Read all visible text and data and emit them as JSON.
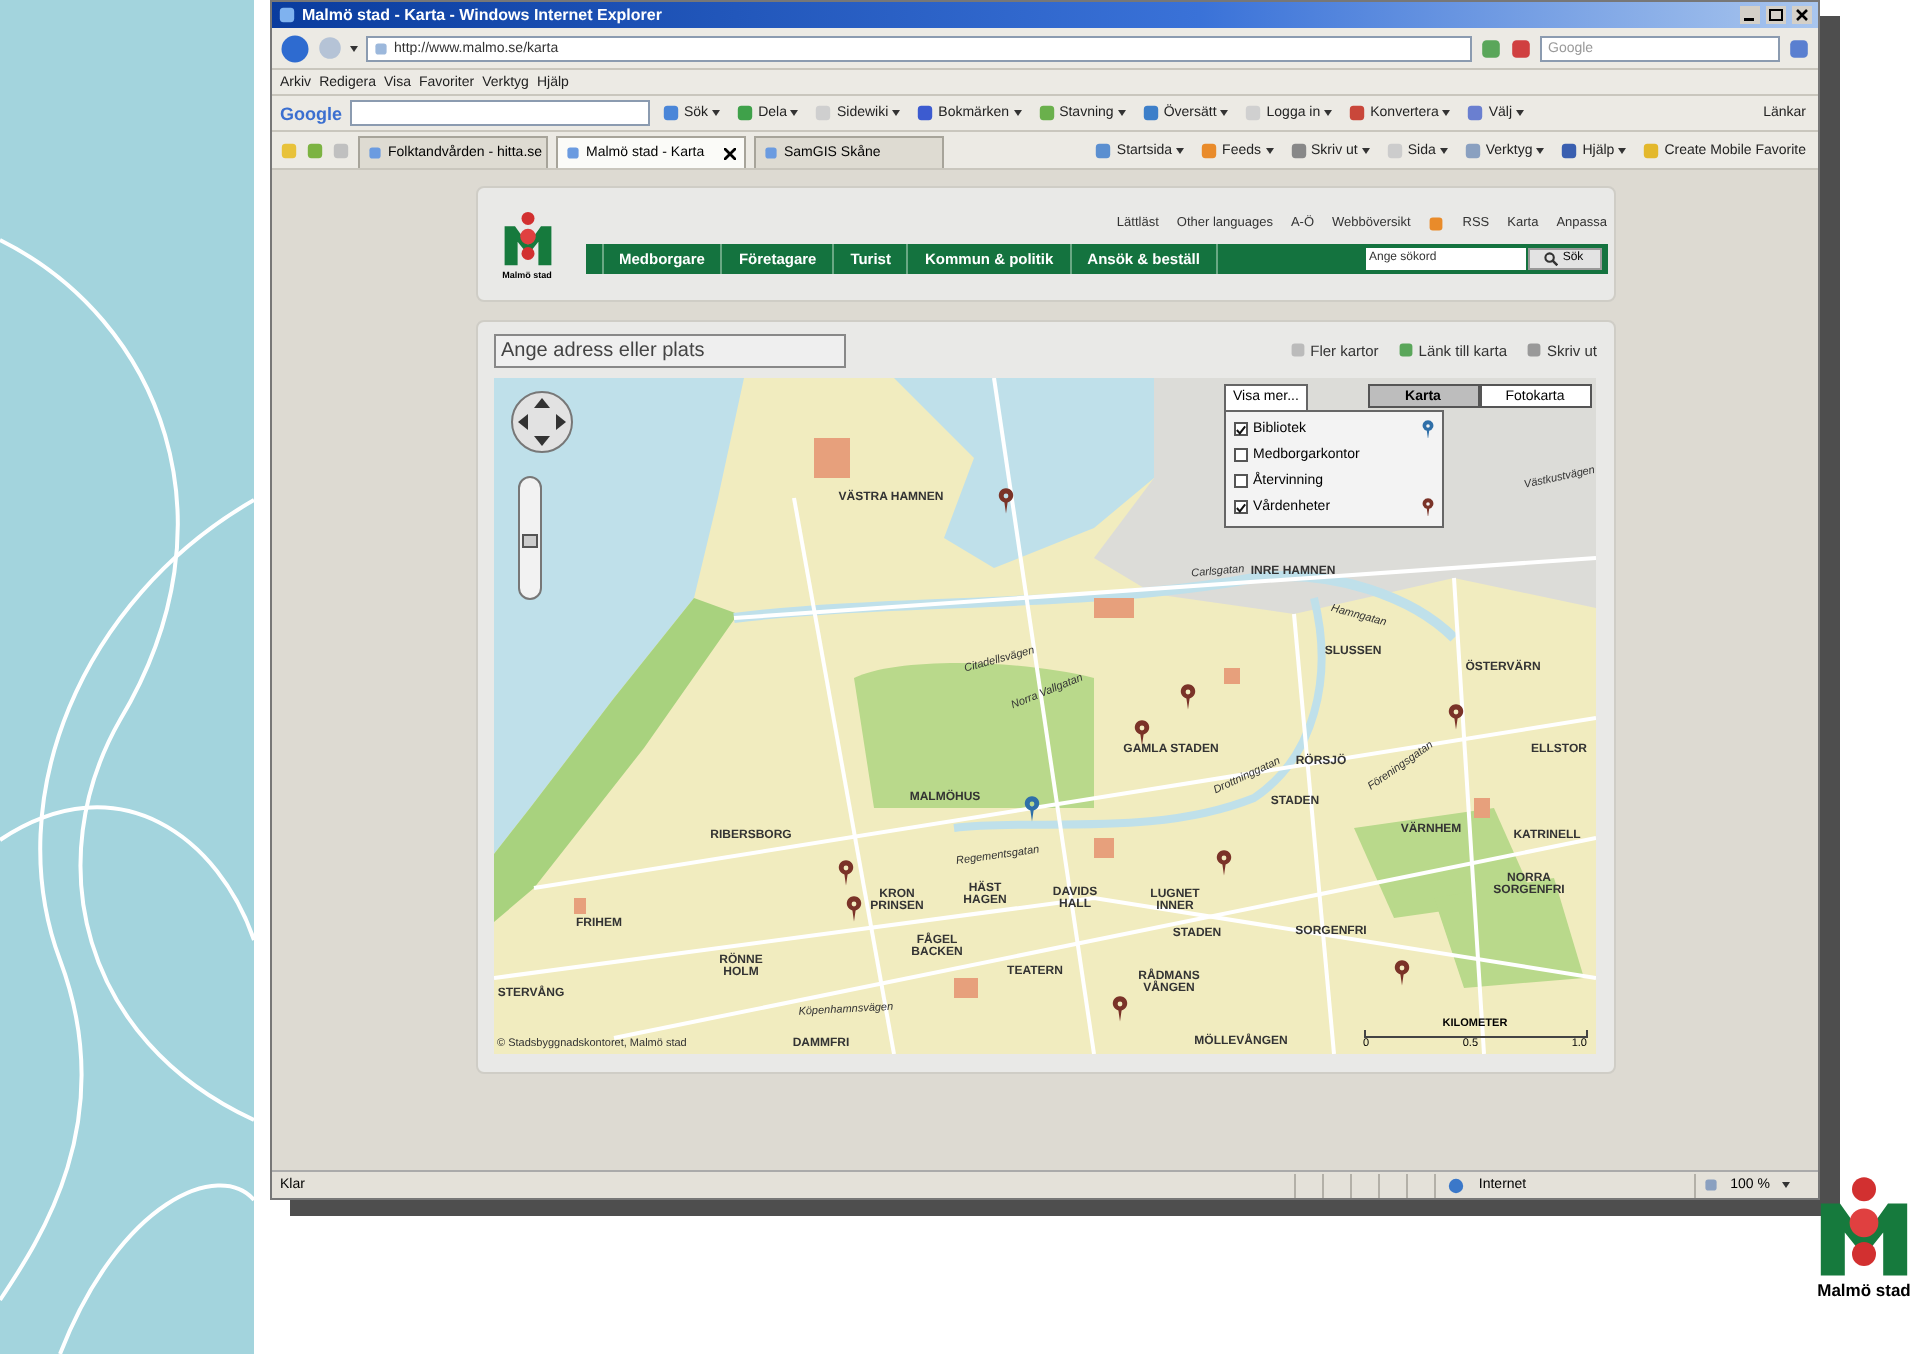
{
  "browser": {
    "title": "Malmö stad - Karta - Windows Internet Explorer",
    "address": "http://www.malmo.se/karta",
    "search_placeholder": "Google",
    "menu": [
      "Arkiv",
      "Redigera",
      "Visa",
      "Favoriter",
      "Verktyg",
      "Hjälp"
    ],
    "google_toolbar": {
      "logo": "Google",
      "items": [
        "Sök",
        "Dela",
        "Sidewiki",
        "Bokmärken",
        "Stavning",
        "Översätt",
        "Logga in",
        "Konvertera",
        "Välj"
      ],
      "links": "Länkar"
    },
    "tabs": [
      {
        "label": "Folktandvården - hitta.se",
        "selected": false
      },
      {
        "label": "Malmö stad - Karta",
        "selected": true
      },
      {
        "label": "SamGIS Skåne",
        "selected": false
      }
    ],
    "command_bar": [
      "Startsida",
      "Feeds",
      "Skriv ut",
      "Sida",
      "Verktyg",
      "Hjälp",
      "Create Mobile Favorite"
    ],
    "status": {
      "text": "Klar",
      "zone": "Internet",
      "zoom": "100 %"
    }
  },
  "site": {
    "logo_text": "Malmö stad",
    "top_links": [
      "Lättläst",
      "Other languages",
      "A-Ö",
      "Webböversikt",
      "RSS",
      "Karta",
      "Anpassa"
    ],
    "nav": [
      "Medborgare",
      "Företagare",
      "Turist",
      "Kommun & politik",
      "Ansök & beställ"
    ],
    "search_placeholder": "Ange sökord",
    "search_button": "Sök"
  },
  "map": {
    "address_placeholder": "Ange adress eller plats",
    "actions": [
      "Fler kartor",
      "Länk till karta",
      "Skriv ut"
    ],
    "view_tabs": [
      {
        "label": "Karta",
        "selected": true
      },
      {
        "label": "Fotokarta",
        "selected": false
      }
    ],
    "layers_tab": "Visa mer...",
    "layers": [
      {
        "label": "Bibliotek",
        "checked": true,
        "color": "#2f6fa8"
      },
      {
        "label": "Medborgarkontor",
        "checked": false
      },
      {
        "label": "Återvinning",
        "checked": false
      },
      {
        "label": "Vårdenheter",
        "checked": true,
        "color": "#7a3328"
      }
    ],
    "zoom_slider": {
      "level": 0.5
    },
    "places": [
      "VÄSTRA HAMNEN",
      "Västkustvägen",
      "Carlsgatan",
      "INRE HAMNEN",
      "Hamngatan",
      "SLUSSEN",
      "ÖSTERVÄRN",
      "Citadellsvägen",
      "Norra Vallgatan",
      "GAMLA STADEN",
      "ELLSTOR",
      "RÖRSJÖ",
      "Drottninggatan",
      "Föreningsgatan",
      "MALMÖHUS",
      "STADEN",
      "VÄRNHEM",
      "RIBERSBORG",
      "KATRINELL",
      "Regementsgatan",
      "NORRA SORGENFRI",
      "KRON PRINSEN",
      "HÄST HAGEN",
      "DAVIDS HALL",
      "LUGNET INNER",
      "FRIHEM",
      "STADEN",
      "SORGENFRI",
      "FÅGEL BACKEN",
      "RÖNNE HOLM",
      "TEATERN",
      "RÅDMANS VÅNGEN",
      "STERVÅNG",
      "Köpenhamnsvägen",
      "DAMMFRI",
      "MÖLLEVÅNGEN"
    ],
    "copyright": "© Stadsbyggnadskontoret, Malmö stad",
    "scale": {
      "title": "KILOMETER",
      "ticks": [
        "0",
        "0.5",
        "1.0"
      ]
    }
  },
  "corner_logo": "Malmö stad"
}
